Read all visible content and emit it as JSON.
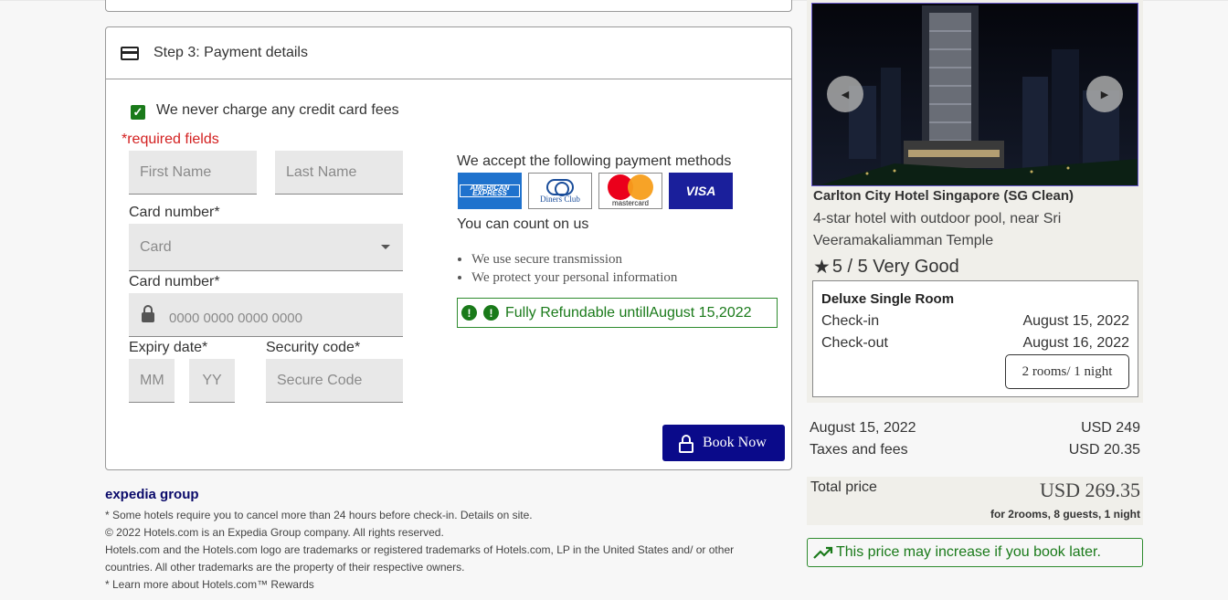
{
  "payment": {
    "step_title": "Step 3: Payment details",
    "no_fee_text": "We never charge any credit card fees",
    "required_text": "*required fields",
    "first_name_placeholder": "First Name",
    "last_name_placeholder": "Last Name",
    "card_type_label": "Card number*",
    "card_type_value": "Card",
    "card_number_label": "Card number*",
    "card_number_placeholder": "0000 0000 0000 0000",
    "expiry_label": "Expiry date*",
    "security_label": "Security code*",
    "mm_placeholder": "MM",
    "yy_placeholder": "YY",
    "security_placeholder": "Secure Code",
    "accept_text": "We accept the following payment methods",
    "logos": {
      "amex": "AMERICAN EXPRESS",
      "diners": "Diners Club",
      "diners_sub": "INTERNATIONAL",
      "mastercard": "mastercard",
      "visa": "VISA"
    },
    "count_on_us": "You can count on us",
    "bullets": [
      "We use secure transmission",
      "We protect your personal information"
    ],
    "refund_text": "Fully Refundable untillAugust 15,2022",
    "book_button": "Book Now"
  },
  "footer": {
    "brand": "expedia group",
    "lines": [
      "* Some hotels require you to cancel more than 24 hours before check-in. Details on site.",
      "© 2022 Hotels.com is an Expedia Group company. All rights reserved.",
      "Hotels.com and the Hotels.com logo are trademarks or registered trademarks of Hotels.com, LP in the United States and/ or other",
      "countries. All other trademarks are the property of their respective owners.",
      "* Learn more about Hotels.com™ Rewards"
    ]
  },
  "hotel": {
    "name": "Carlton City Hotel Singapore (SG Clean)",
    "description": "4-star hotel with outdoor pool, near Sri Veeramakaliamman Temple",
    "rating": "5 / 5 Very Good",
    "room_type": "Deluxe Single Room",
    "checkin_label": "Check-in",
    "checkin_date": "August 15, 2022",
    "checkout_label": "Check-out",
    "checkout_date": "August 16, 2022",
    "rooms_nights": "2 rooms/ 1 night"
  },
  "price": {
    "date_label": "August 15, 2022",
    "date_amount": "USD 249",
    "taxes_label": "Taxes and fees",
    "taxes_amount": "USD 20.35",
    "total_label": "Total price",
    "total_amount": "USD 269.35",
    "total_sub": "for 2rooms, 8 guests, 1 night",
    "increase_warning": "This price may increase if you book later."
  },
  "colors": {
    "primary_button": "#0a0a8a",
    "success_green": "#1a7a1a",
    "required_red": "#d32020"
  }
}
